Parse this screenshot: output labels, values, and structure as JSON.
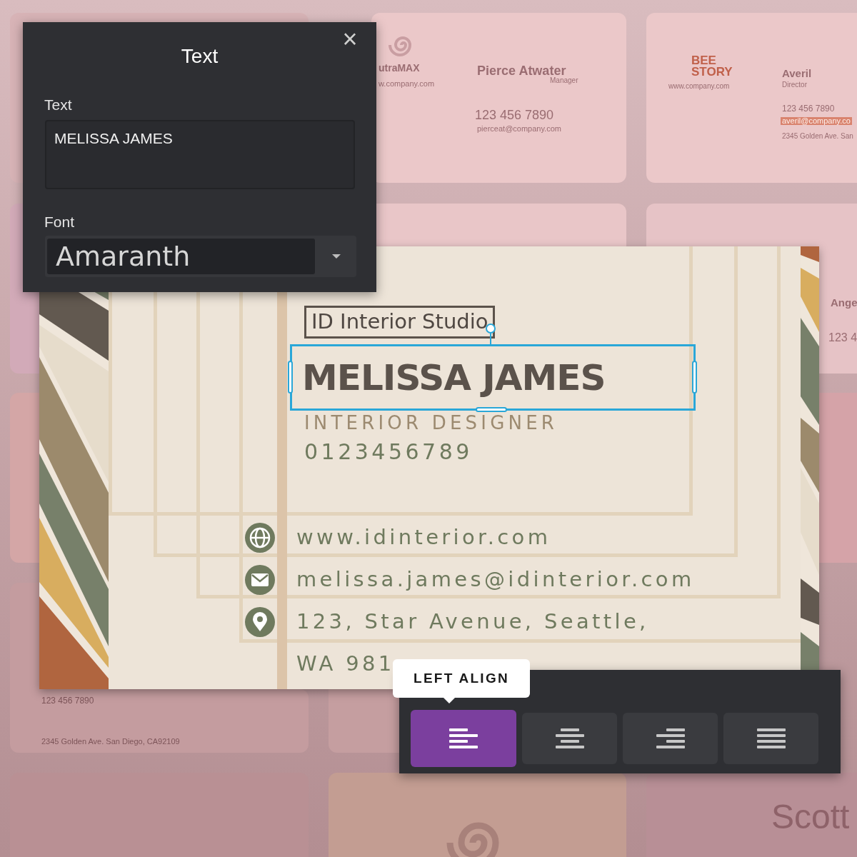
{
  "templates": [
    {
      "lines": [
        "utraMAX",
        "w.company.com",
        "Pierce Atwater",
        "Manager",
        "123 456 7890",
        "pierceat@company.com"
      ]
    },
    {
      "lines": [
        "BEE",
        "STORY",
        "www.company.com",
        "Averil",
        "Director",
        "123 456 7890",
        "averil@company.co",
        "2345 Golden Ave. San"
      ]
    },
    {
      "lines": [
        "Ange",
        "123 4"
      ]
    },
    {
      "lines": [
        "123 456 7890",
        "2345 Golden Ave. San Diego, CA92109"
      ]
    },
    {
      "lines": [
        "Scott"
      ]
    }
  ],
  "text_panel": {
    "title": "Text",
    "close": "×",
    "text_label": "Text",
    "text_value": "MELISSA JAMES",
    "font_label": "Font",
    "font_value": "Amaranth"
  },
  "card": {
    "company": "ID Interior Studio",
    "name": "MELISSA JAMES",
    "name_selected": true,
    "job_title": "INTERIOR DESIGNER",
    "phone": "0123456789",
    "contacts": [
      {
        "kind": "web",
        "text": "www.idinterior.com"
      },
      {
        "kind": "email",
        "text": "melissa.james@idinterior.com"
      },
      {
        "kind": "location",
        "text": "123, Star Avenue, Seattle,"
      }
    ],
    "address_line_2": "WA 981"
  },
  "align_toolbar": {
    "tooltip": "LEFT ALIGN",
    "buttons": [
      {
        "kind": "left",
        "selected": true
      },
      {
        "kind": "center",
        "selected": false
      },
      {
        "kind": "right",
        "selected": false
      },
      {
        "kind": "justify",
        "selected": false
      }
    ]
  }
}
